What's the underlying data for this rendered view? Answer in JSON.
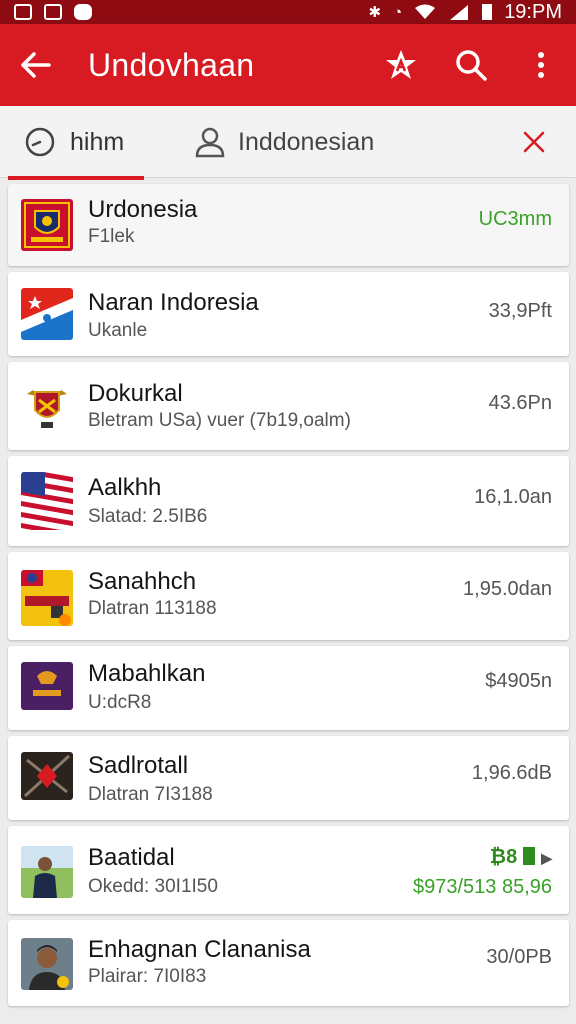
{
  "status_bar": {
    "time": "19:PM"
  },
  "app_bar": {
    "title": "Undovhaan"
  },
  "search": {
    "tab_label": "hihm",
    "query": "Inddonesian"
  },
  "colors": {
    "primary": "#d81b22",
    "status_bar": "#8e0b12",
    "green": "#3aa128"
  },
  "items": [
    {
      "title": "Urdonesia",
      "subtitle": "F1lek",
      "value": "UC3mm",
      "thumb": "crest-red"
    },
    {
      "title": "Naran Indoresia",
      "subtitle": "Ukanle",
      "value": "33,9Pft",
      "thumb": "flag-red-blue"
    },
    {
      "title": "Dokurkal",
      "subtitle": "Bletram USa) vuer (7b19,oalm)",
      "value": "43.6Pn",
      "thumb": "emblem-shield"
    },
    {
      "title": "Aalkhh",
      "subtitle": "Slatad: 2.5IB6",
      "value": "16,1.0an",
      "thumb": "flag-us"
    },
    {
      "title": "Sanahhch",
      "subtitle": "Dlatran 113188",
      "value": "1,95.0dan",
      "thumb": "yellow-badge"
    },
    {
      "title": "Mabahlkan",
      "subtitle": "U:dcR8",
      "value": "$4905n",
      "thumb": "purple-logo"
    },
    {
      "title": "Sadlrotall",
      "subtitle": "Dlatran 7I3188",
      "value": "1,96.6dB",
      "thumb": "dark-diamond"
    },
    {
      "title": "Baatidal",
      "subtitle": "Okedd: 30I1I50",
      "value": "$973/513 85,96",
      "value_top": "₿8",
      "thumb": "person-outdoor"
    },
    {
      "title": "Enhagnan Clananisa",
      "subtitle": "Plairar: 7I0I83",
      "value": "30/0PB",
      "thumb": "person-portrait"
    }
  ]
}
